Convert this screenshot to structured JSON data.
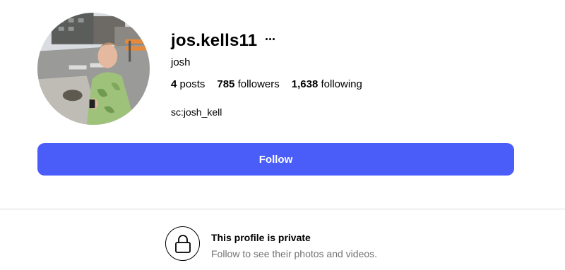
{
  "profile": {
    "username": "jos.kells11",
    "full_name": "josh",
    "bio": "sc:josh_kell",
    "avatar_icon": "profile-photo",
    "more_icon": "ellipsis-icon"
  },
  "stats": {
    "posts_count": "4",
    "posts_label": "posts",
    "followers_count": "785",
    "followers_label": "followers",
    "following_count": "1,638",
    "following_label": "following"
  },
  "actions": {
    "follow_label": "Follow",
    "accent_color": "#4a5df9"
  },
  "private_notice": {
    "icon": "lock-icon",
    "title": "This profile is private",
    "subtitle": "Follow to see their photos and videos."
  }
}
